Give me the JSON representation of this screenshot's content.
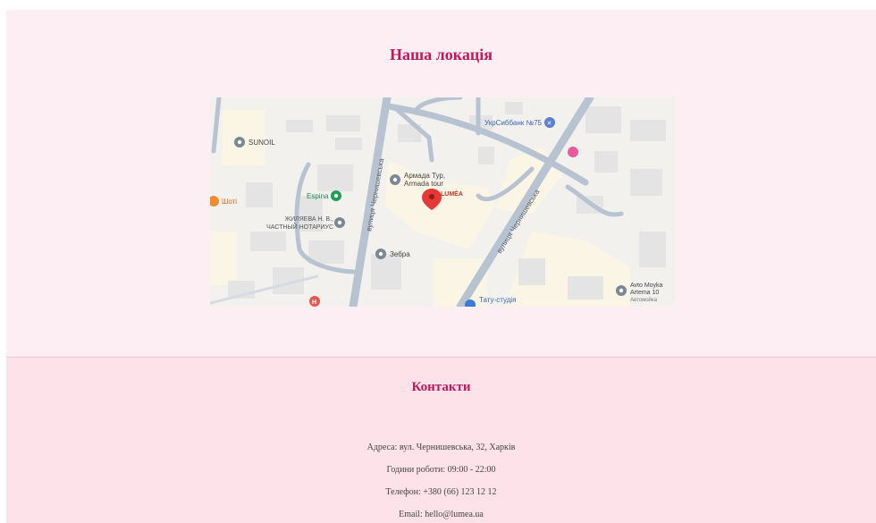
{
  "location": {
    "title": "Наша локація",
    "map": {
      "streets": [
        "вулиця Чернишевська",
        "вулиця Чернишевська"
      ],
      "places": [
        {
          "label": "SUNOIL",
          "icon": "gray-pin-icon"
        },
        {
          "label": "УкрСиббанк №75",
          "icon": "bank-icon"
        },
        {
          "label": "Армада Тур,",
          "label2": "Armada tour",
          "icon": "gray-pin-icon"
        },
        {
          "label": "LUMÉA",
          "icon": "red-marker-icon"
        },
        {
          "label": "Espina",
          "icon": "green-pin-icon"
        },
        {
          "label": "Шоті",
          "icon": "food-pin-icon"
        },
        {
          "label": "ЖИЛЯЕВА Н. В.,",
          "label2": "ЧАСТНЫЙ НОТАРИУС",
          "icon": "gray-pin-icon"
        },
        {
          "label": "Зебра",
          "icon": "gray-pin-icon"
        },
        {
          "label": "Тату-студія",
          "icon": "blue-pin-icon"
        },
        {
          "label": "Avto Moyka",
          "label2": "Artema 10",
          "label3": "Автомойка",
          "icon": "gray-pin-icon"
        }
      ],
      "colors": {
        "road": "#b7c3d0",
        "block": "#e5e5e5",
        "land": "#f3f1ee",
        "highlight": "#fbf5e6"
      }
    }
  },
  "contacts": {
    "title": "Контакти",
    "address": "Адреса: вул. Чернишевська, 32, Харків",
    "hours": "Години роботи: 09:00 - 22:00",
    "phone": "Телефон: +380 (66) 123 12 12",
    "email": "Email: hello@lumea.ua"
  },
  "colors": {
    "accent": "#c2185b",
    "section_bg": "#fdeef3",
    "footer_bg": "#fde2ea"
  }
}
